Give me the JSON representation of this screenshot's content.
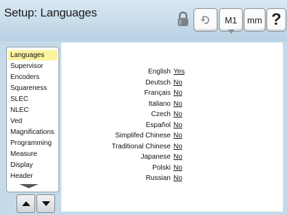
{
  "header": {
    "title": "Setup: Languages",
    "buttons": {
      "undo_icon": "undo-arrow-icon",
      "m1_label": "M1",
      "mm_label": "mm",
      "help_label": "?"
    },
    "lock_icon": "padlock-icon"
  },
  "sidebar": {
    "items": [
      {
        "label": "Languages",
        "selected": true
      },
      {
        "label": "Supervisor"
      },
      {
        "label": "Encoders"
      },
      {
        "label": "Squareness"
      },
      {
        "label": "SLEC"
      },
      {
        "label": "NLEC"
      },
      {
        "label": "Ved"
      },
      {
        "label": "Magnifications"
      },
      {
        "label": "Programming"
      },
      {
        "label": "Measure"
      },
      {
        "label": "Display"
      },
      {
        "label": "Header"
      }
    ],
    "more_indicator_icon": "scroll-down-arrow-icon",
    "nav": {
      "up_icon": "up-arrow-icon",
      "down_icon": "down-arrow-icon"
    }
  },
  "languages": [
    {
      "name": "English",
      "value": "Yes"
    },
    {
      "name": "Deutsch",
      "value": "No"
    },
    {
      "name": "Français",
      "value": "No"
    },
    {
      "name": "Italiano",
      "value": "No"
    },
    {
      "name": "Czech",
      "value": "No"
    },
    {
      "name": "Español",
      "value": "No"
    },
    {
      "name": "Simplifed Chinese",
      "value": "No"
    },
    {
      "name": "Traditional Chinese",
      "value": "No"
    },
    {
      "name": "Japanese",
      "value": "No"
    },
    {
      "name": "Polski",
      "value": "No"
    },
    {
      "name": "Russian",
      "value": "No"
    }
  ],
  "colors": {
    "background": "#c6dbea",
    "selected_item": "#fbf39f",
    "panel": "#ffffff"
  }
}
